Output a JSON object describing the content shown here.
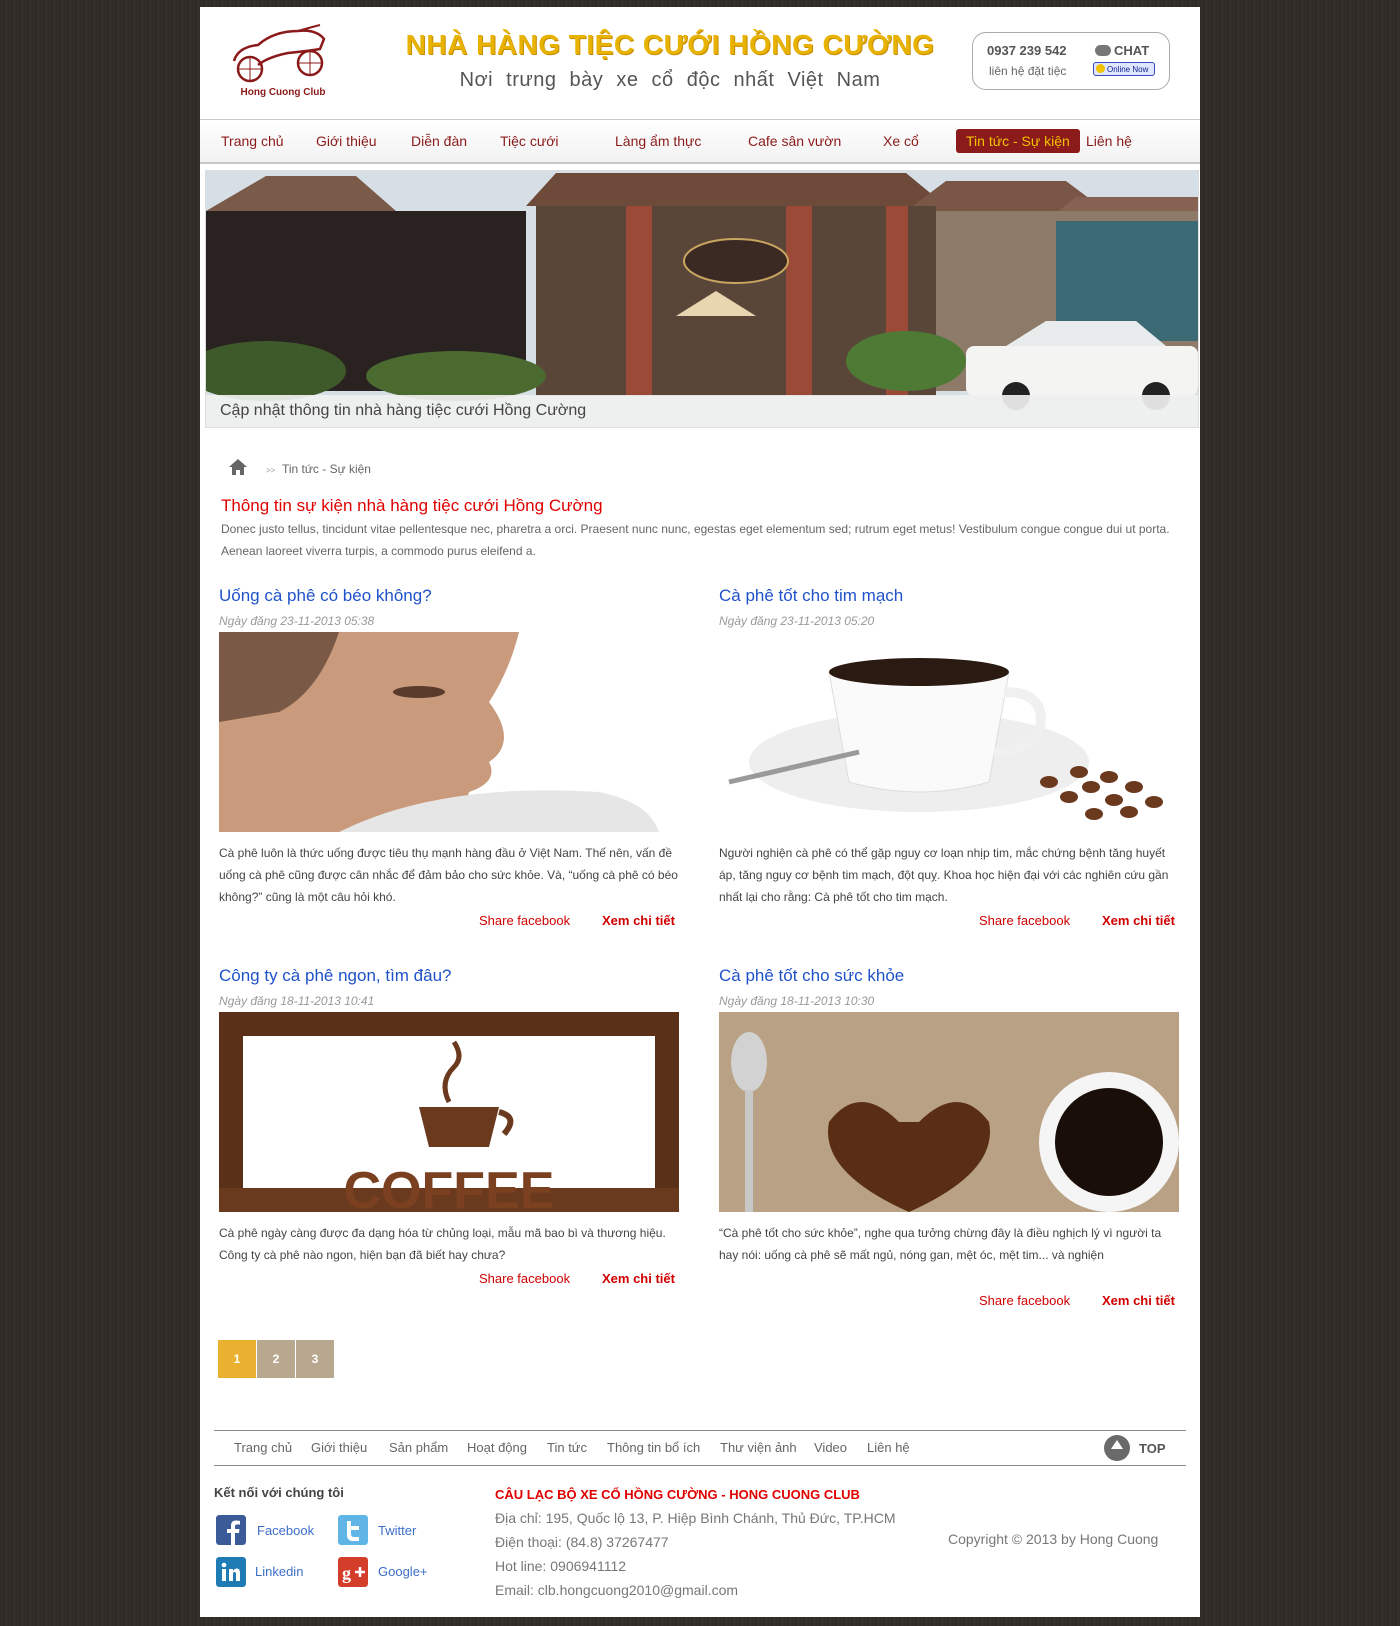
{
  "header": {
    "logo_text": "Hong Cuong Club",
    "title": "NHÀ HÀNG TIỆC CƯỚI HỒNG CƯỜNG",
    "subtitle": "Nơi trưng bày xe cổ độc nhất Việt Nam",
    "phone": "0937 239 542",
    "phone_note": "liên hệ đặt tiệc",
    "chat_label": "CHAT",
    "online_label": "Online Now"
  },
  "nav": {
    "items": [
      "Trang chủ",
      "Giới thiệu",
      "Diễn đàn",
      "Tiệc cưới",
      "Làng ẩm thực",
      "Cafe sân vườn",
      "Xe cổ",
      "Tin tức - Sự kiện",
      "Liên hệ"
    ],
    "active": "Tin tức - Sự kiện"
  },
  "banner": {
    "caption": "Cập nhật thông tin nhà hàng tiệc cưới Hồng Cường"
  },
  "breadcrumb": {
    "separator": ">>",
    "current": "Tin tức - Sự kiện"
  },
  "section": {
    "title": "Thông tin sự kiện nhà hàng tiệc cưới Hồng Cường",
    "description": "Donec justo tellus, tincidunt vitae pellentesque nec, pharetra a orci. Praesent nunc nunc, egestas eget elementum sed; rutrum eget metus! Vestibulum congue congue dui ut porta. Aenean laoreet viverra turpis, a commodo purus eleifend a."
  },
  "articles": [
    {
      "title": "Uống cà phê có béo không?",
      "date": "Ngày đăng 23-11-2013 05:38",
      "excerpt": "Cà phê luôn là thức uống được tiêu thụ mạnh hàng đầu ở Việt Nam. Thế nên, vấn đề uống cà phê cũng được cân nhắc để đảm bảo cho sức khỏe. Và, “uống cà phê có béo không?” cũng là một câu hỏi khó.",
      "share_label": "Share facebook",
      "more_label": "Xem chi tiết"
    },
    {
      "title": "Cà phê tốt cho tim mạch",
      "date": "Ngày đăng 23-11-2013 05:20",
      "excerpt": "Người nghiện cà phê có thể gặp nguy cơ loạn nhịp tim, mắc chứng bệnh tăng huyết áp, tăng nguy cơ bệnh tim mạch, đột quỵ. Khoa học hiện đại với các nghiên cứu gần nhất lại cho rằng: Cà phê tốt cho tim mạch.",
      "share_label": "Share facebook",
      "more_label": "Xem chi tiết"
    },
    {
      "title": "Công ty cà phê ngon, tìm đâu?",
      "date": "Ngày đăng 18-11-2013 10:41",
      "excerpt": "Cà phê ngày càng được đa dạng hóa từ chủng loại, mẫu mã bao bì và thương hiệu. Công ty cà phê nào ngon, hiện bạn đã biết hay chưa?",
      "share_label": "Share facebook",
      "more_label": "Xem chi tiết",
      "image_text": "COFFEE"
    },
    {
      "title": "Cà phê tốt cho sức khỏe",
      "date": "Ngày đăng 18-11-2013 10:30",
      "excerpt": "“Cà phê tốt cho sức khỏe”, nghe qua tưởng chừng đây là điều nghịch lý vì người ta hay nói: uống cà phê sẽ mất ngủ, nóng gan, mệt óc, mệt tim... và nghiện",
      "share_label": "Share facebook",
      "more_label": "Xem chi tiết"
    }
  ],
  "pagination": {
    "pages": [
      "1",
      "2",
      "3"
    ],
    "current": "1"
  },
  "footer": {
    "nav": [
      "Trang chủ",
      "Giới thiệu",
      "Sản phẩm",
      "Hoạt động",
      "Tin tức",
      "Thông tin bổ ích",
      "Thư viện ảnh",
      "Video",
      "Liên hệ"
    ],
    "top_label": "TOP",
    "connect_title": "Kết nối với chúng tôi",
    "social": [
      "Facebook",
      "Twitter",
      "Linkedin",
      "Google+"
    ],
    "club_name": "CÂU LẠC BỘ XE CỔ HỒNG CƯỜNG - HONG CUONG CLUB",
    "address": "Địa chỉ: 195, Quốc lộ 13, P. Hiệp Bình Chánh, Thủ Đức, TP.HCM",
    "phone": "Điện thoại: (84.8) 37267477",
    "hotline": "Hot line: 0906941112",
    "email": "Email: clb.hongcuong2010@gmail.com",
    "copyright": "Copyright © 2013 by Hong Cuong"
  },
  "colors": {
    "accent": "#8b1a1a",
    "title_gold": "#e8b200",
    "link_blue": "#1f52c9",
    "red": "#e00000",
    "pager_active": "#eab030"
  },
  "icons": [
    "car-logo-icon",
    "chat-bubble-icon",
    "smiley-icon",
    "home-icon",
    "arrow-up-icon",
    "facebook-icon",
    "twitter-icon",
    "linkedin-icon",
    "google-plus-icon"
  ]
}
